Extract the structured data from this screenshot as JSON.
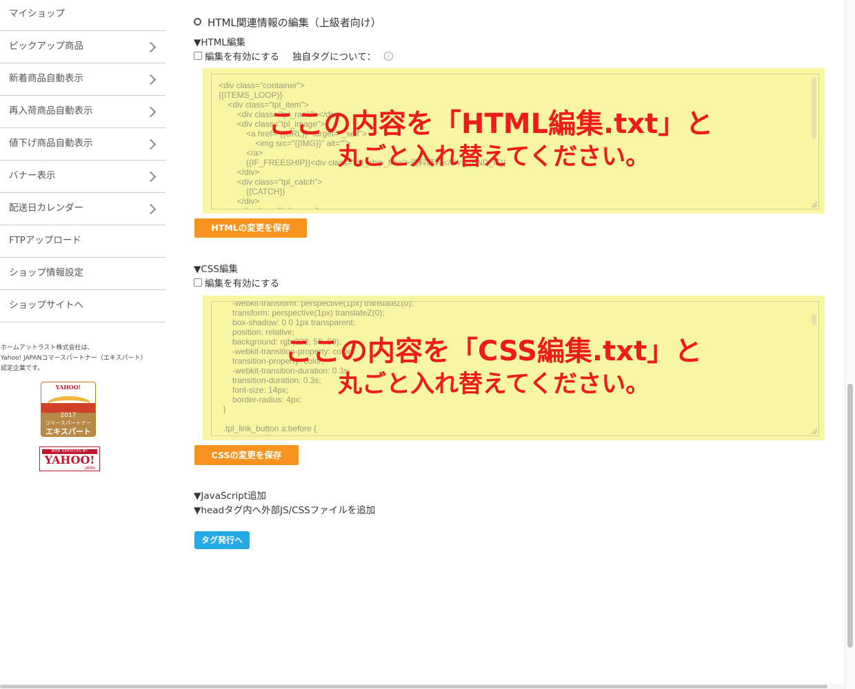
{
  "sidebar": {
    "items": [
      {
        "label": "マイショップ",
        "arrow": false
      },
      {
        "label": "ピックアップ商品",
        "arrow": true
      },
      {
        "label": "新着商品自動表示",
        "arrow": true
      },
      {
        "label": "再入荷商品自動表示",
        "arrow": true
      },
      {
        "label": "値下げ商品自動表示",
        "arrow": true
      },
      {
        "label": "バナー表示",
        "arrow": true
      },
      {
        "label": "配送日カレンダー",
        "arrow": true
      },
      {
        "label": "FTPアップロード",
        "arrow": false
      },
      {
        "label": "ショップ情報設定",
        "arrow": false
      },
      {
        "label": "ショップサイトへ",
        "arrow": false
      }
    ],
    "note_lines": [
      "ホームアットラスト株式会社は、",
      "Yahoo! JAPANコマースパートナー（エキスパート）",
      "認定企業です。"
    ],
    "badge": {
      "top": "YAHOO!",
      "year": "2017",
      "line1": "コマースパートナー",
      "line2": "エキスパート"
    },
    "web_services": {
      "header": "WEB SERVICES BY",
      "logo": "YAHOO!",
      "sub": "JAPAN"
    }
  },
  "main": {
    "heading": "HTML関連情報の編集（上級者向け）",
    "html_section": {
      "label": "▼HTML編集",
      "checkbox_label": "編集を有効にする",
      "custom_tag_label": "独自タグについて：",
      "info_icon": "info-icon",
      "code": "<div class=\"container\">\n{{ITEMS_LOOP}}\n    <div class=\"tpl_item\">\n        <div class=\"tpl_rank\"></div>\n        <div class=\"tpl_image\">\n            <a href=\"{{URL}}\" target=\"_self\">\n                <img src=\"{{IMG}}\" alt=\"\">\n            </a>\n            {{IF_FREESHIP}}<div class=\"tpl_ship_free\">送料無料</div>{{END_IF}}\n        </div>\n        <div class=\"tpl_catch\">\n            {{CATCH}}\n        </div>\n        <div class=\"tpl_name\">",
      "overlay_line1": "ここの内容を「HTML編集.txt」と",
      "overlay_line2": "丸ごと入れ替えてください。",
      "save_button": "HTMLの変更を保存"
    },
    "css_section": {
      "label": "▼CSS編集",
      "checkbox_label": "編集を有効にする",
      "code": "      -webkit-transform: perspective(1px) translateZ(0);\n      transform: perspective(1px) translateZ(0);\n      box-shadow: 0 0 1px transparent;\n      position: relative;\n      background: rgb(222, 50, 50);\n      -webkit-transition-property: color;\n      transition-property: color;\n      -webkit-transition-duration: 0.3s;\n      transition-duration: 0.3s;\n      font-size: 14px;\n      border-radius: 4px;\n  }\n\n  .tpl_link_button a:before {\n      content: \"\";",
      "overlay_line1": "ここの内容を「CSS編集.txt」と",
      "overlay_line2": "丸ごと入れ替えてください。",
      "save_button": "CSSの変更を保存"
    },
    "js_label": "▼JavaScript追加",
    "head_label": "▼headタグ内へ外部JS/CSSファイルを追加",
    "tag_button": "タグ発行へ"
  },
  "colors": {
    "editor_bg": "#f8f6a3",
    "overlay_red": "#ee1b1b",
    "orange_button": "#f7931e",
    "blue_button": "#22a9e6"
  }
}
